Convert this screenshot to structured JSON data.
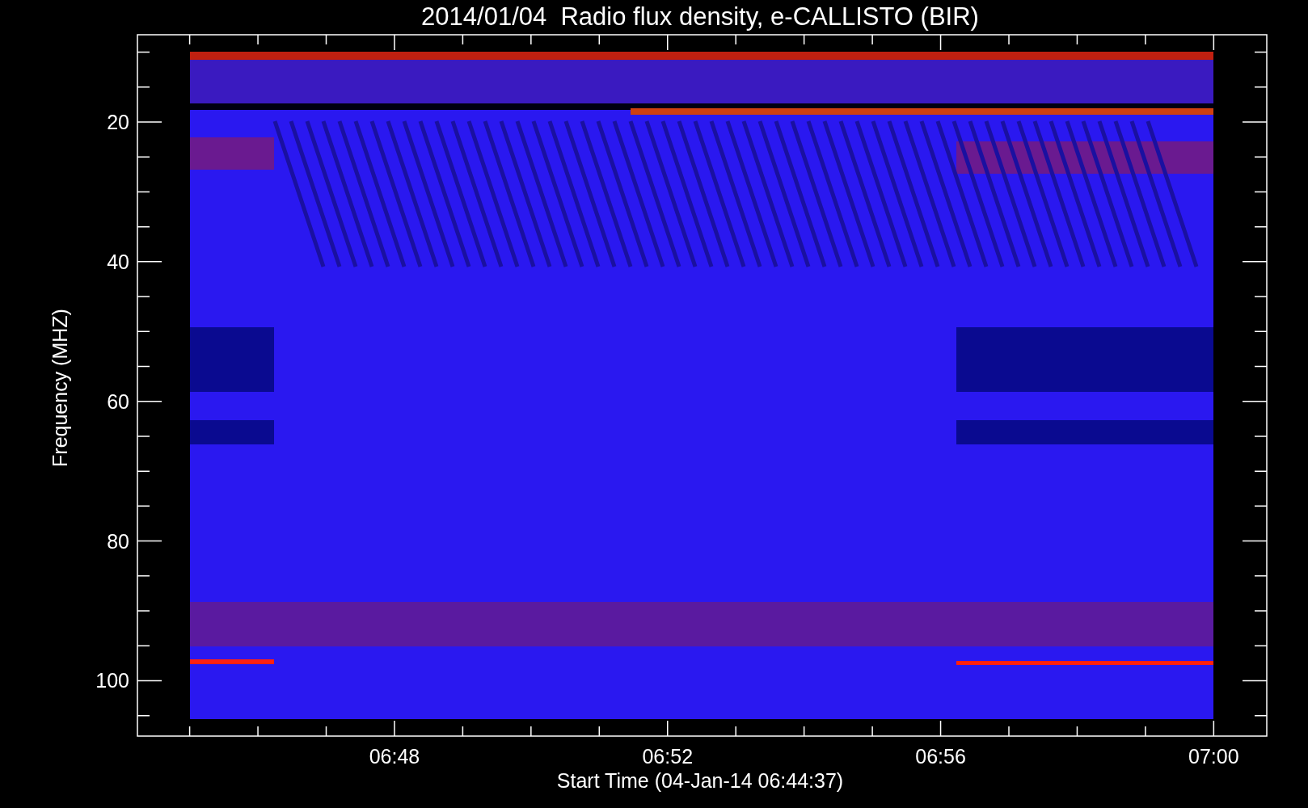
{
  "title": "2014/01/04  Radio flux density, e-CALLISTO (BIR)",
  "y_axis": {
    "label": "Frequency (MHZ)",
    "ticks": [
      "20",
      "40",
      "60",
      "80",
      "100"
    ]
  },
  "x_axis": {
    "label": "Start Time (04-Jan-14 06:44:37)",
    "ticks": [
      "06:48",
      "06:52",
      "06:56",
      "07:00"
    ]
  }
}
